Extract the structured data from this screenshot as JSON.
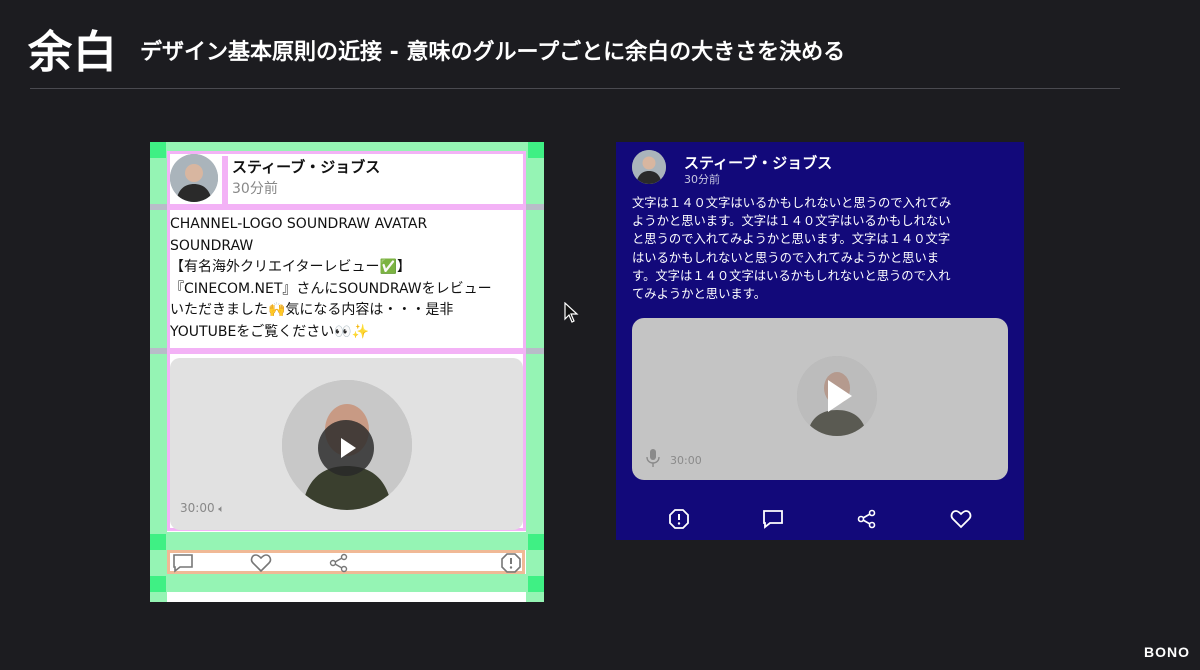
{
  "slide": {
    "title": "余白",
    "subtitle": "デザイン基本原則の近接 - 意味のグループごとに余白の大きさを決める",
    "brand": "BONO"
  },
  "left_card": {
    "user_name": "スティーブ・ジョブス",
    "time": "30分前",
    "body_lines": [
      "CHANNEL-LOGO SOUNDRAW AVATAR",
      "SOUNDRAW",
      "【有名海外クリエイターレビュー✅】",
      "『CINECOM.NET』さんにSOUNDRAWをレビュー",
      "いただきました🙌気になる内容は・・・是非",
      "YOUTUBEをご覧ください👀✨"
    ],
    "video_duration": "30:00",
    "actions": [
      "comment-icon",
      "heart-icon",
      "share-icon",
      "report-icon"
    ],
    "colors": {
      "margin_band": "#95f4b4",
      "corner": "#3ff084",
      "group_outline": "#f3b2f6",
      "action_outline": "#f0b996"
    }
  },
  "right_card": {
    "user_name": "スティーブ・ジョブス",
    "time": "30分前",
    "body_lines": [
      "文字は１４０文字はいるかもしれないと思うので入れてみ",
      "ようかと思います。文字は１４０文字はいるかもしれない",
      "と思うので入れてみようかと思います。文字は１４０文字",
      "はいるかもしれないと思うので入れてみようかと思いま",
      "す。文字は１４０文字はいるかもしれないと思うので入れ",
      "てみようかと思います。"
    ],
    "video_duration": "30:00",
    "actions": [
      "report-icon",
      "comment-icon",
      "share-icon",
      "heart-icon"
    ],
    "colors": {
      "background": "#12097a"
    }
  }
}
